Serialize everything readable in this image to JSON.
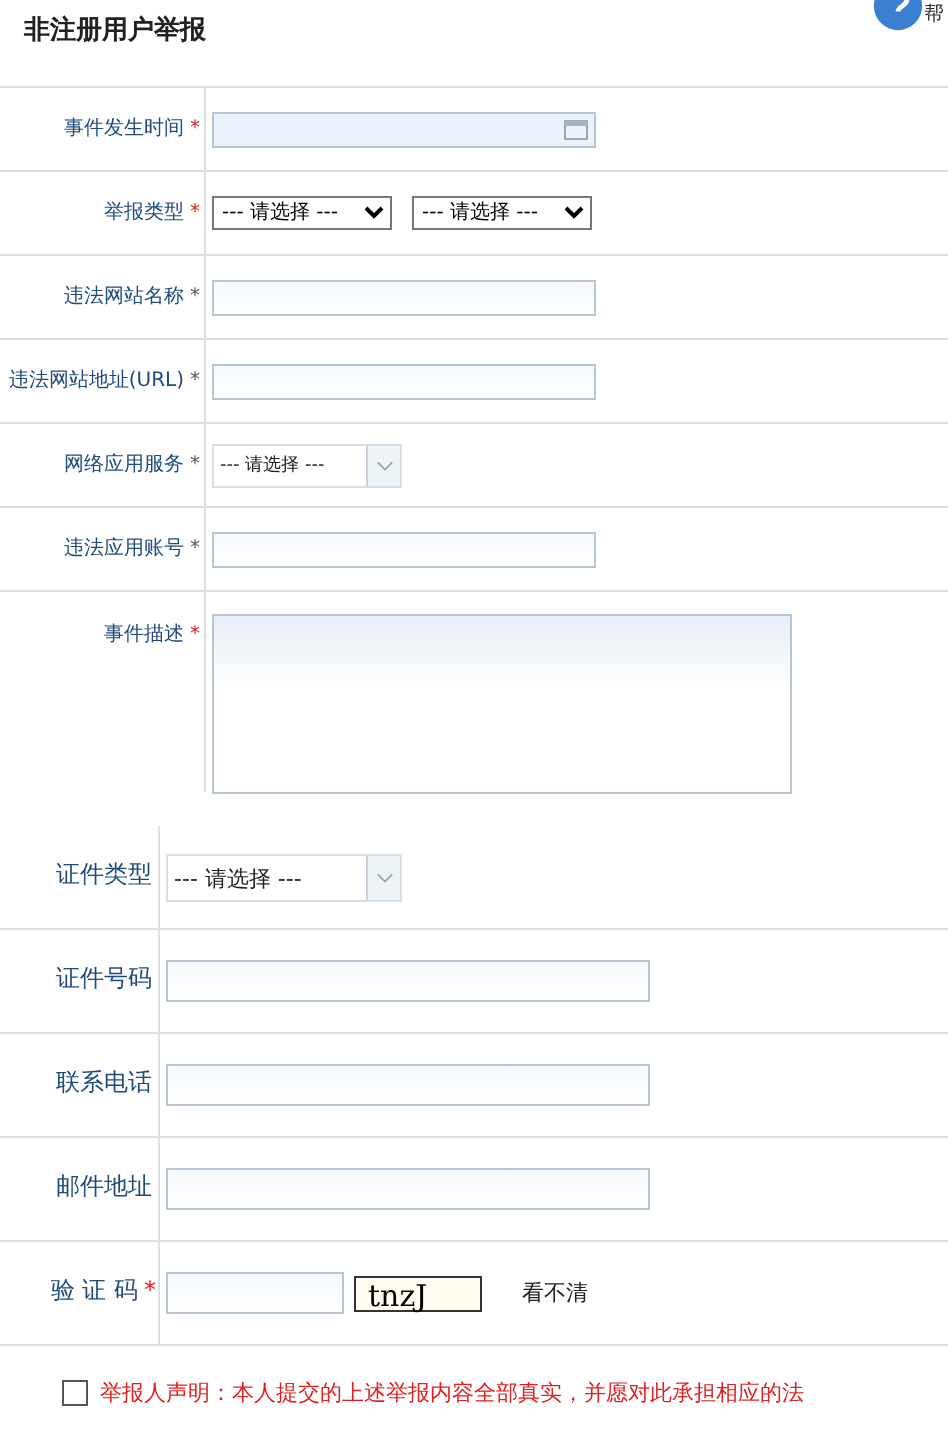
{
  "title": "非注册用户举报",
  "help_label": "帮",
  "report_fields": [
    {
      "label": "事件发生时间",
      "mark": "*",
      "color": "#e02020",
      "kind": "date"
    },
    {
      "label": "举报类型",
      "mark": "*",
      "color": "#e02020",
      "kind": "select2",
      "options": [
        "--- 请选择 ---",
        "--- 请选择 ---"
      ]
    },
    {
      "label": "违法网站名称",
      "mark": "*",
      "color": "#555555",
      "kind": "text"
    },
    {
      "label": "违法网站地址(URL)",
      "mark": "*",
      "color": "#555555",
      "kind": "text"
    },
    {
      "label": "网络应用服务",
      "mark": "*",
      "color": "#555555",
      "kind": "combo",
      "value": "--- 请选择 ---"
    },
    {
      "label": "违法应用账号",
      "mark": "*",
      "color": "#555555",
      "kind": "text"
    },
    {
      "label": "事件描述",
      "mark": "*",
      "color": "#e02020",
      "kind": "textarea"
    }
  ],
  "contact_fields": [
    {
      "label": "证件类型",
      "kind": "combo",
      "value": "--- 请选择 ---"
    },
    {
      "label": "证件号码",
      "kind": "text"
    },
    {
      "label": "联系电话",
      "kind": "text"
    },
    {
      "label": "邮件地址",
      "kind": "text"
    },
    {
      "label": "验 证 码",
      "mark": "*",
      "color": "#e02020",
      "kind": "captcha",
      "captcha": "tnzJ",
      "refresh": "看不清"
    }
  ],
  "declaration": {
    "checked": false,
    "text": "举报人声明：本人提交的上述举报内容全部真实，并愿对此承担相应的法"
  }
}
